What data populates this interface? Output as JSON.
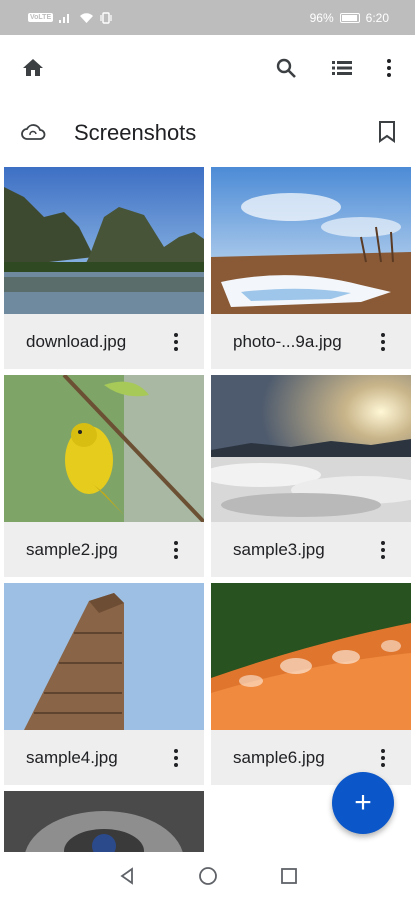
{
  "status_bar": {
    "carrier_chip": "VoLTE",
    "battery_text": "96%",
    "battery_level": 0.96,
    "time": "6:20"
  },
  "toolbar": {
    "icons": [
      "home-icon",
      "search-icon",
      "list-view-icon",
      "more-vert-icon"
    ]
  },
  "folder": {
    "title": "Screenshots",
    "icons": [
      "cloud-sync-icon",
      "bookmark-icon"
    ]
  },
  "files": [
    {
      "name": "download.jpg"
    },
    {
      "name": "photo-...9a.jpg"
    },
    {
      "name": "sample2.jpg"
    },
    {
      "name": "sample3.jpg"
    },
    {
      "name": "sample4.jpg"
    },
    {
      "name": "sample6.jpg"
    },
    {
      "name": ""
    }
  ],
  "fab": {
    "label": "+"
  },
  "colors": {
    "status_bar": "#bdbdbd",
    "caption_bg": "#eeeeee",
    "fab": "#0b57c9"
  }
}
